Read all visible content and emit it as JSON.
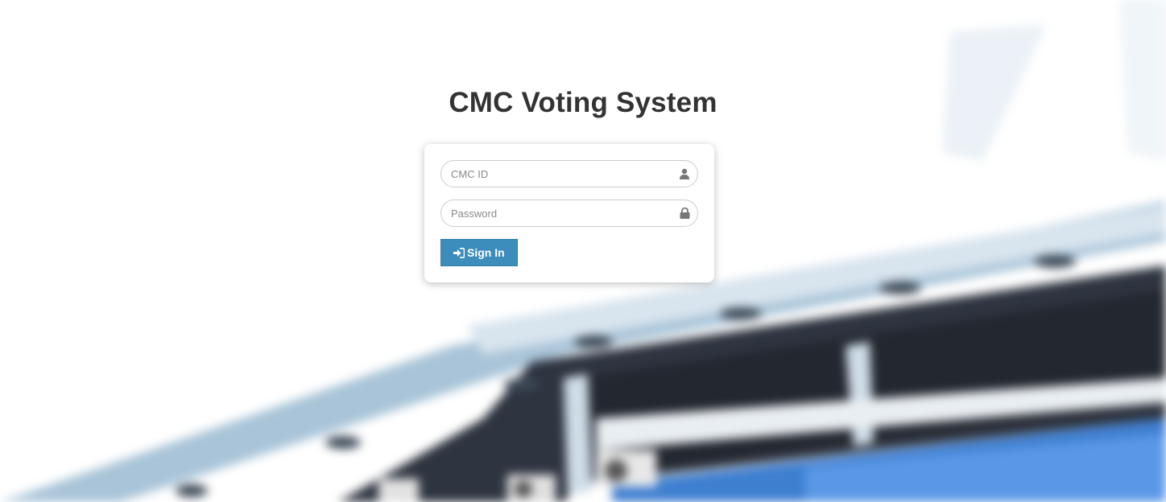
{
  "page": {
    "title": "CMC Voting System"
  },
  "login_form": {
    "id_field": {
      "placeholder": "CMC ID",
      "value": "",
      "icon": "user-icon"
    },
    "password_field": {
      "placeholder": "Password",
      "value": "",
      "icon": "lock-icon"
    },
    "submit": {
      "label": "Sign In",
      "icon": "sign-in-icon"
    }
  },
  "colors": {
    "primary": "#3c8dbc",
    "title": "#333333",
    "card_bg": "#ffffff"
  }
}
